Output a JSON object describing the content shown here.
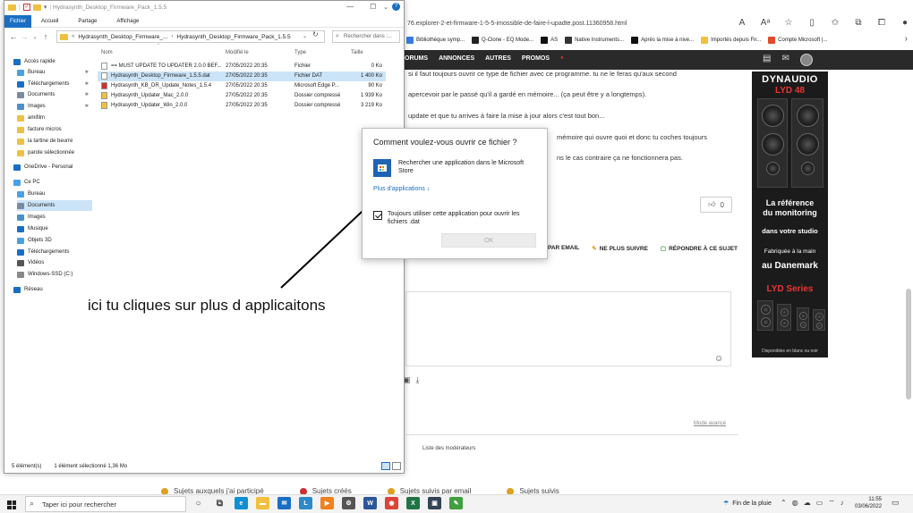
{
  "browser": {
    "url": "76.explorer-2-et-firmware-1-5-5-imossible-de-faire-l-upadte.post.11360958.html",
    "bookmarks": [
      {
        "label": "Bibliothèque symp...",
        "color": "#3b7be0"
      },
      {
        "label": "Q-Clone - EQ Mode...",
        "color": "#222222"
      },
      {
        "label": "AS",
        "color": "#111111"
      },
      {
        "label": "Native Instruments...",
        "color": "#333333"
      },
      {
        "label": "Après la mise à nive...",
        "color": "#111111"
      },
      {
        "label": "Importés depuis Fir...",
        "color": "#f0c040"
      },
      {
        "label": "Compte Microsoft |...",
        "color": "#e24a2a"
      }
    ]
  },
  "site": {
    "nav": [
      "ORUMS",
      "ANNONCES",
      "AUTRES",
      "PROMOS"
    ],
    "lines": [
      "si il faut toujours ouvrir ce type de fichier avec ce programme. tu ne le feras qu'aux second",
      "apercevoir par le passé qu'il a gardé en mémoire... (ça peut être y a longtemps).",
      "update et que tu arrives à faire la mise à jour alors c'est tout bon...",
      "mémoire qui ouvre quoi et donc tu coches toujours",
      "ns le cas contraire ça ne fonctionnera pas."
    ],
    "like_count": "0",
    "actions": [
      "PAR EMAIL",
      "NE PLUS SUIVRE",
      "RÉPONDRE À CE SUJET"
    ],
    "mode_avance": "Mode avancé",
    "liste_moderateurs": "Liste des modérateurs",
    "bottom_links": [
      {
        "label": "Sujets auxquels j'ai participé",
        "color": "#e0a020"
      },
      {
        "label": "Sujets créés",
        "color": "#d03030"
      },
      {
        "label": "Sujets suivis par email",
        "color": "#e0a020"
      },
      {
        "label": "Sujets suivis",
        "color": "#e0a020"
      }
    ]
  },
  "ad": {
    "brand": "DYNAUDIO",
    "model": "LYD 48",
    "headline_1": "La référence",
    "headline_2": "du monitoring",
    "sub": "dans votre studio",
    "fab_1": "Fabriquée à la main",
    "fab_2": "au Danemark",
    "series": "LYD Series",
    "avail": "Disponibles en blanc ou noir"
  },
  "explorer": {
    "title": "Hydrasynth_Desktop_Firmware_Pack_1.5.5",
    "ribbon_tabs": [
      "Fichier",
      "Accueil",
      "Partage",
      "Affichage"
    ],
    "path": [
      "Hydrasynth_Desktop_Firmware_...",
      "Hydrasynth_Desktop_Firmware_Pack_1.5.5"
    ],
    "search_placeholder": "Rechercher dans :...",
    "nav_items": [
      {
        "label": "Accès rapide",
        "icon": "star-icon",
        "color": "#1a6fc4",
        "pin": false,
        "indent": 0
      },
      {
        "label": "Bureau",
        "icon": "desktop-icon",
        "color": "#4aa0e6",
        "pin": true,
        "indent": 1
      },
      {
        "label": "Téléchargements",
        "icon": "download-icon",
        "color": "#1a6fc4",
        "pin": true,
        "indent": 1
      },
      {
        "label": "Documents",
        "icon": "documents-icon",
        "color": "#7a8aa0",
        "pin": true,
        "indent": 1
      },
      {
        "label": "Images",
        "icon": "images-icon",
        "color": "#4a90d0",
        "pin": true,
        "indent": 1
      },
      {
        "label": "amifilm",
        "icon": "folder-icon",
        "color": "#f0c040",
        "pin": false,
        "indent": 1
      },
      {
        "label": "facture micros",
        "icon": "folder-icon",
        "color": "#f0c040",
        "pin": false,
        "indent": 1
      },
      {
        "label": "la tartine de beurre",
        "icon": "folder-icon",
        "color": "#f0c040",
        "pin": false,
        "indent": 1
      },
      {
        "label": "parole sélectionnée",
        "icon": "folder-icon",
        "color": "#f0c040",
        "pin": false,
        "indent": 1
      },
      {
        "label": "OneDrive - Personal",
        "icon": "cloud-icon",
        "color": "#1a6fc4",
        "pin": false,
        "indent": 0
      },
      {
        "label": "Ce PC",
        "icon": "pc-icon",
        "color": "#4aa0e6",
        "pin": false,
        "indent": 0
      },
      {
        "label": "Bureau",
        "icon": "desktop-icon",
        "color": "#4aa0e6",
        "pin": false,
        "indent": 1
      },
      {
        "label": "Documents",
        "icon": "documents-icon",
        "color": "#7a8aa0",
        "pin": false,
        "indent": 1,
        "selected": true
      },
      {
        "label": "Images",
        "icon": "images-icon",
        "color": "#4a90d0",
        "pin": false,
        "indent": 1
      },
      {
        "label": "Musique",
        "icon": "music-icon",
        "color": "#1a6fc4",
        "pin": false,
        "indent": 1
      },
      {
        "label": "Objets 3D",
        "icon": "cube-icon",
        "color": "#4aa0e6",
        "pin": false,
        "indent": 1
      },
      {
        "label": "Téléchargements",
        "icon": "download-icon",
        "color": "#1a6fc4",
        "pin": false,
        "indent": 1
      },
      {
        "label": "Vidéos",
        "icon": "video-icon",
        "color": "#555555",
        "pin": false,
        "indent": 1
      },
      {
        "label": "Windows-SSD (C:)",
        "icon": "drive-icon",
        "color": "#888888",
        "pin": false,
        "indent": 1
      },
      {
        "label": "Réseau",
        "icon": "network-icon",
        "color": "#1a6fc4",
        "pin": false,
        "indent": 0
      }
    ],
    "columns": [
      "Nom",
      "Modifié le",
      "Type",
      "Taille"
    ],
    "files": [
      {
        "name": "== MUST UPDATE TO UPDATER 2.0.0 BEF...",
        "date": "27/05/2022 20:35",
        "type": "Fichier",
        "size": "0 Ko",
        "icon": "file-icon",
        "color": "#ffffff",
        "selected": false
      },
      {
        "name": "Hydrasynth_Desktop_Firmware_1.5.5.dat",
        "date": "27/05/2022 20:35",
        "type": "Fichier DAT",
        "size": "1 400 Ko",
        "icon": "file-icon",
        "color": "#ffffff",
        "selected": true
      },
      {
        "name": "Hydrasynth_KB_DR_Update_Notes_1.5.4",
        "date": "27/05/2022 20:35",
        "type": "Microsoft Edge P...",
        "size": "90 Ko",
        "icon": "pdf-icon",
        "color": "#d03030",
        "selected": false
      },
      {
        "name": "Hydrasynth_Updater_Mac_2.0.0",
        "date": "27/05/2022 20:35",
        "type": "Dossier compressé",
        "size": "1 939 Ko",
        "icon": "zip-icon",
        "color": "#f0c040",
        "selected": false
      },
      {
        "name": "Hydrasynth_Updater_Win_2.0.0",
        "date": "27/05/2022 20:35",
        "type": "Dossier compressé",
        "size": "3 219 Ko",
        "icon": "zip-icon",
        "color": "#f0c040",
        "selected": false
      }
    ],
    "status_count": "5 élément(s)",
    "status_selected": "1 élément sélectionné  1,36 Mo"
  },
  "annotation": "ici tu cliques sur plus d applicaitons",
  "dialog": {
    "title": "Comment voulez-vous ouvrir ce fichier ?",
    "store_option": "Rechercher une application dans le Microsoft Store",
    "more_apps": "Plus d'applications ↓",
    "always_use": "Toujours utiliser cette application pour ouvrir les fichiers .dat",
    "always_checked": true,
    "ok": "OK"
  },
  "taskbar": {
    "search_placeholder": "Taper ici pour rechercher",
    "apps": [
      {
        "name": "cortana-icon",
        "color": "#444444",
        "glyph": "○"
      },
      {
        "name": "task-view-icon",
        "color": "#444444",
        "glyph": "⧉"
      },
      {
        "name": "edge-icon",
        "color": "#0f8fd6",
        "glyph": "e"
      },
      {
        "name": "file-explorer-icon",
        "color": "#f0c040",
        "glyph": "▬"
      },
      {
        "name": "mail-icon",
        "color": "#1a6fc4",
        "glyph": "✉"
      },
      {
        "name": "l-app-icon",
        "color": "#2d8ac8",
        "glyph": "L"
      },
      {
        "name": "orange-app-icon",
        "color": "#f08020",
        "glyph": "▶"
      },
      {
        "name": "settings-icon",
        "color": "#555555",
        "glyph": "⚙"
      },
      {
        "name": "word-icon",
        "color": "#2b579a",
        "glyph": "W"
      },
      {
        "name": "chrome-icon",
        "color": "#db4437",
        "glyph": "◉"
      },
      {
        "name": "excel-icon",
        "color": "#217346",
        "glyph": "X"
      },
      {
        "name": "media-app-icon",
        "color": "#334455",
        "glyph": "▣"
      },
      {
        "name": "green-app-icon",
        "color": "#40a040",
        "glyph": "✎"
      }
    ],
    "weather": "Fin de la pluie",
    "time": "11:55",
    "date": "03/06/2022"
  }
}
